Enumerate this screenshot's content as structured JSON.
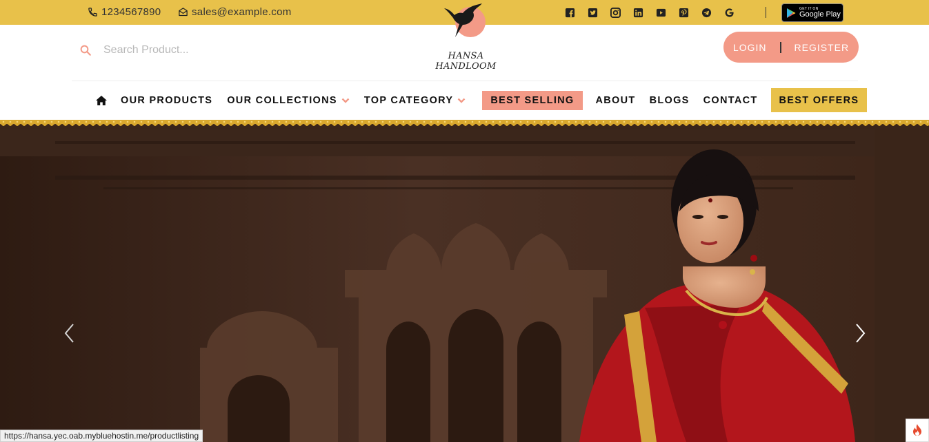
{
  "topbar": {
    "phone": "1234567890",
    "email": "sales@example.com",
    "socials": [
      "facebook-icon",
      "twitter-icon",
      "instagram-icon",
      "linkedin-icon",
      "youtube-icon",
      "pinterest-icon",
      "telegram-icon",
      "google-icon"
    ],
    "google_play_small": "GET IT ON",
    "google_play_big": "Google Play"
  },
  "brand": {
    "name": "HANSA HANDLOOM"
  },
  "search": {
    "placeholder": "Search Product..."
  },
  "auth": {
    "login": "LOGIN",
    "register": "REGISTER"
  },
  "nav": {
    "items": [
      {
        "label": "OUR PRODUCTS"
      },
      {
        "label": "OUR COLLECTIONS"
      },
      {
        "label": "TOP CATEGORY"
      },
      {
        "label": "BEST SELLING"
      },
      {
        "label": "ABOUT"
      },
      {
        "label": "BLOGS"
      },
      {
        "label": "CONTACT"
      },
      {
        "label": "BEST OFFERS"
      }
    ]
  },
  "status_url": "https://hansa.yec.oab.mybluehostin.me/productlisting",
  "colors": {
    "topbar": "#e8c14a",
    "accent_pink": "#f39a87",
    "hero_bg": "#3a2519",
    "saree_red": "#b3161c"
  }
}
